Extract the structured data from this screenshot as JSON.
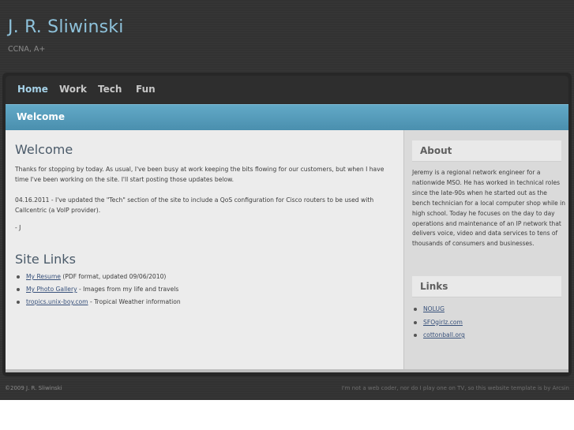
{
  "header": {
    "title": "J. R. Sliwinski",
    "subtitle": "CCNA, A+"
  },
  "nav": {
    "items": [
      {
        "label": "Home",
        "active": true
      },
      {
        "label": "Work",
        "active": false
      },
      {
        "label": "Tech",
        "active": false
      },
      {
        "label": "Fun",
        "active": false
      }
    ]
  },
  "banner": {
    "title": "Welcome"
  },
  "main": {
    "welcome_heading": "Welcome",
    "paragraphs": [
      "Thanks for stopping by today. As usual, I've been busy at work keeping the bits flowing for our customers, but when I have time I've been working on the site. I'll start posting those updates below.",
      "04.16.2011 - I've updated the \"Tech\" section of the site to include a QoS configuration for Cisco routers to be used with Callcentric (a VoIP provider).",
      "- J"
    ],
    "site_links_heading": "Site Links",
    "site_links": [
      {
        "link": "My Resume",
        "text": " (PDF format, updated 09/06/2010)"
      },
      {
        "link": "My Photo Gallery",
        "text": " - Images from my life and travels"
      },
      {
        "link": "tropics.unix-boy.com",
        "text": " - Tropical Weather information"
      }
    ]
  },
  "sidebar": {
    "about_title": "About",
    "about_text": "Jeremy is a regional network engineer for a nationwide MSO. He has worked in technical roles since the late-90s when he started out as the bench technician for a local computer shop while in high school. Today he focuses on the day to day operations and maintenance of an IP network that delivers voice, video and data services to tens of thousands of consumers and businesses.",
    "links_title": "Links",
    "links": [
      "NOLUG",
      "SFOgirlz.com",
      "cottonball.org"
    ]
  },
  "footer": {
    "copyright": "©2009 J. R. Sliwinski",
    "credit": "I'm not a web coder, nor do I play one on TV, so this website template is by Arcsin"
  },
  "colors": {
    "title_blue": "#8ec2db",
    "banner_blue": "#5aa0bf",
    "background_dark": "#323232",
    "content_bg": "#ececec",
    "sidebar_bg": "#dadada",
    "link": "#37507a"
  }
}
